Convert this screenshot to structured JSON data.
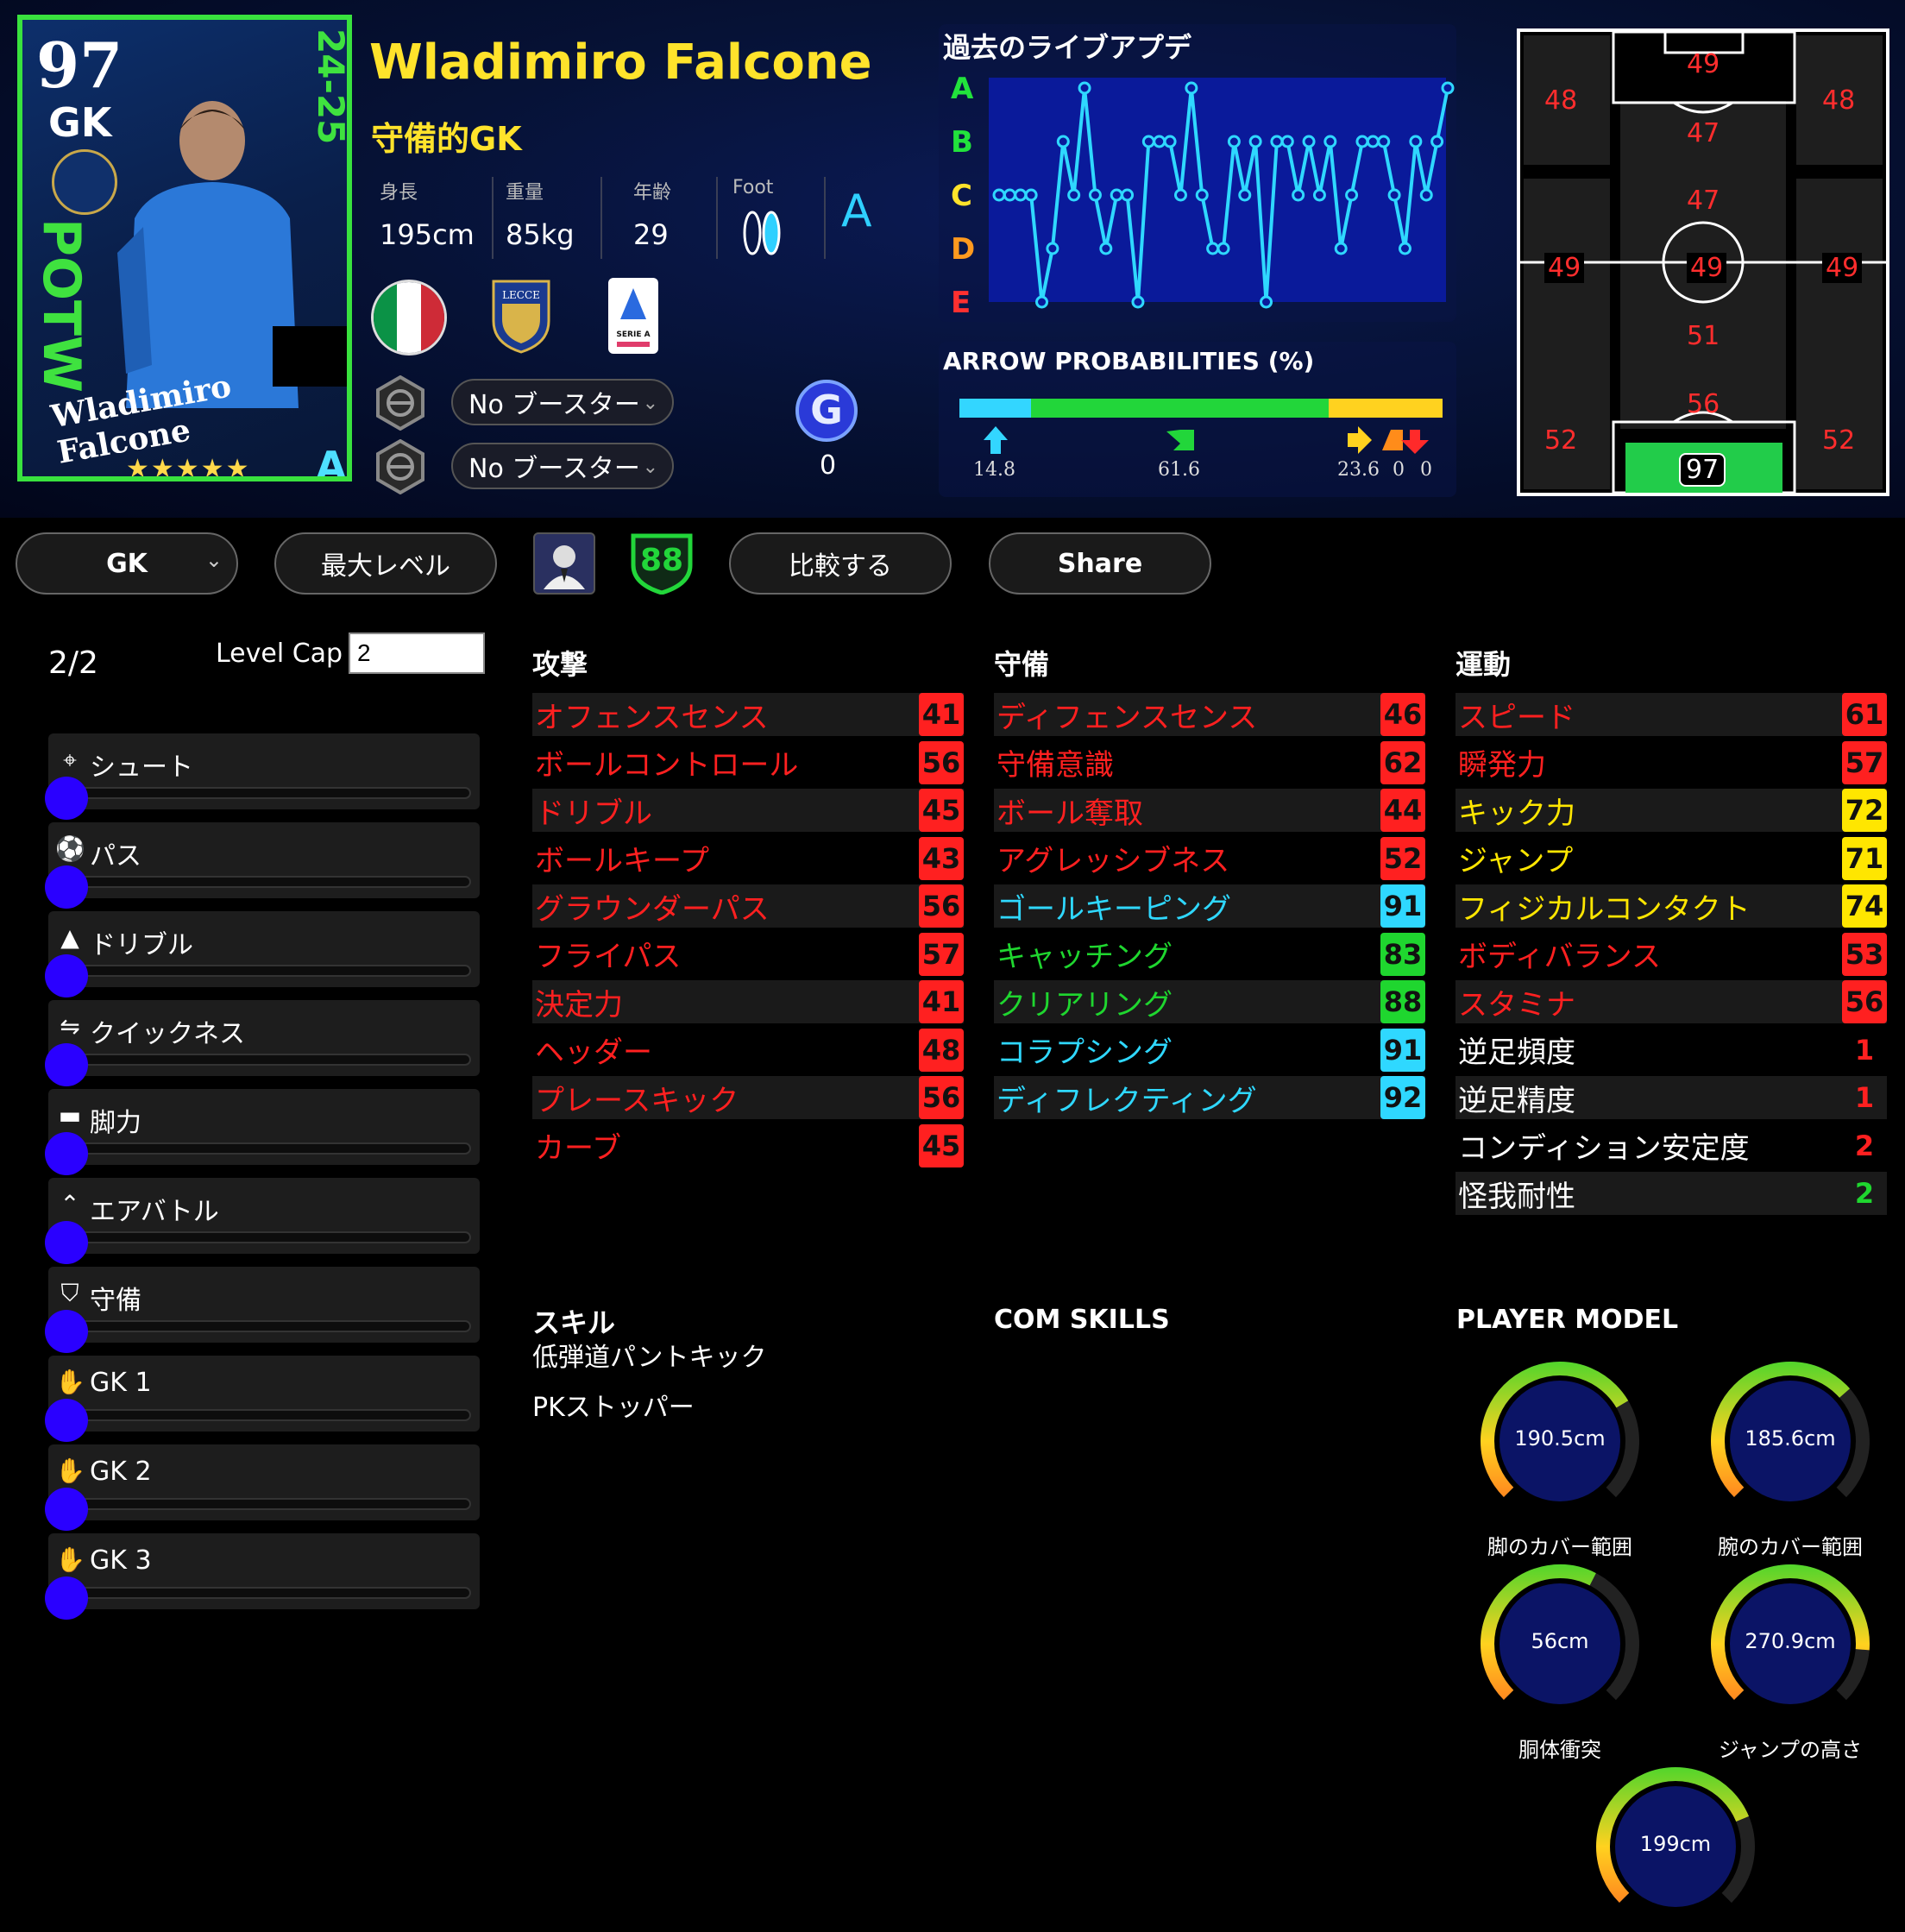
{
  "card": {
    "ovr": "97",
    "pos": "GK",
    "season": "24-25",
    "potw": "POTW",
    "name": "Wladimiro Falcone",
    "stars": "★★★★★",
    "grade": "A"
  },
  "player": {
    "name": "Wladimiro Falcone",
    "role": "守備的GK",
    "height_label": "身長",
    "height": "195cm",
    "weight_label": "重量",
    "weight": "85kg",
    "age_label": "年齢",
    "age": "29",
    "foot_label": "Foot",
    "foot_grade": "A",
    "league_text": "SERIE A",
    "club_text": "LECCE"
  },
  "boosters": [
    {
      "label": "No ブースター"
    },
    {
      "label": "No ブースター"
    }
  ],
  "g_badge": {
    "letter": "G",
    "count": "0"
  },
  "live_update": {
    "title": "過去のライブアプデ",
    "grades": [
      "A",
      "B",
      "C",
      "D",
      "E"
    ],
    "grade_colors": [
      "#22e23c",
      "#22e23c",
      "#ffe32b",
      "#ff9a1f",
      "#ff3030"
    ],
    "history": [
      "C",
      "C",
      "C",
      "C",
      "E",
      "D",
      "B",
      "C",
      "A",
      "C",
      "D",
      "C",
      "C",
      "E",
      "B",
      "B",
      "B",
      "C",
      "A",
      "C",
      "D",
      "D",
      "B",
      "C",
      "B",
      "E",
      "B",
      "B",
      "C",
      "B",
      "C",
      "B",
      "D",
      "C",
      "B",
      "B",
      "B",
      "C",
      "D",
      "B",
      "C",
      "B",
      "A"
    ]
  },
  "arrow_prob": {
    "title": "ARROW PROBABILITIES (%)",
    "values": [
      14.8,
      61.6,
      23.6,
      0,
      0
    ],
    "labels": [
      "14.8",
      "61.6",
      "23.6",
      "0",
      "0"
    ],
    "colors": [
      "#33d6ff",
      "#22d63a",
      "#ffd21f",
      "#ff8c1a",
      "#ff2a2a"
    ]
  },
  "positions": {
    "top_center": "49",
    "top_left": "48",
    "top_right": "48",
    "upper_mid": "47",
    "mid_top": "47",
    "left_mid": "49",
    "center": "49",
    "right_mid": "49",
    "mid_low": "51",
    "low_center": "56",
    "low_left": "52",
    "low_right": "52",
    "gk": "97"
  },
  "toolbar": {
    "position_select": "GK",
    "max_level": "最大レベル",
    "compare": "比較する",
    "share": "Share",
    "badge_value": "88"
  },
  "progression": {
    "count": "2/2",
    "level_cap_label": "Level Cap",
    "level_cap_value": "2",
    "items": [
      {
        "label": "シュート",
        "icon": "crosshair-icon",
        "glyph": "⌖",
        "level": 0
      },
      {
        "label": "パス",
        "icon": "ball-icon",
        "glyph": "⚽",
        "level": 0
      },
      {
        "label": "ドリブル",
        "icon": "cone-icon",
        "glyph": "▲",
        "level": 0
      },
      {
        "label": "クイックネス",
        "icon": "arrows-icon",
        "glyph": "⇋",
        "level": 0
      },
      {
        "label": "脚力",
        "icon": "boot-icon",
        "glyph": "▬",
        "level": 0
      },
      {
        "label": "エアバトル",
        "icon": "double-chevron-up-icon",
        "glyph": "⌃",
        "level": 0
      },
      {
        "label": "守備",
        "icon": "shield-icon",
        "glyph": "⛉",
        "level": 0
      },
      {
        "label": "GK 1",
        "icon": "glove-icon",
        "glyph": "✋",
        "level": 0
      },
      {
        "label": "GK 2",
        "icon": "glove-icon",
        "glyph": "✋",
        "level": 0
      },
      {
        "label": "GK 3",
        "icon": "glove-icon",
        "glyph": "✋",
        "level": 0
      }
    ]
  },
  "stats": {
    "colors": {
      "red": "#ff2020",
      "yellow": "#ffe600",
      "green": "#1fd62f",
      "cyan": "#2fd8ff"
    },
    "attack": {
      "title": "攻撃",
      "rows": [
        {
          "name": "オフェンスセンス",
          "value": "41",
          "tier": "red"
        },
        {
          "name": "ボールコントロール",
          "value": "56",
          "tier": "red"
        },
        {
          "name": "ドリブル",
          "value": "45",
          "tier": "red"
        },
        {
          "name": "ボールキープ",
          "value": "43",
          "tier": "red"
        },
        {
          "name": "グラウンダーパス",
          "value": "56",
          "tier": "red"
        },
        {
          "name": "フライパス",
          "value": "57",
          "tier": "red"
        },
        {
          "name": "決定力",
          "value": "41",
          "tier": "red"
        },
        {
          "name": "ヘッダー",
          "value": "48",
          "tier": "red"
        },
        {
          "name": "プレースキック",
          "value": "56",
          "tier": "red"
        },
        {
          "name": "カーブ",
          "value": "45",
          "tier": "red"
        }
      ]
    },
    "defense": {
      "title": "守備",
      "rows": [
        {
          "name": "ディフェンスセンス",
          "value": "46",
          "tier": "red"
        },
        {
          "name": "守備意識",
          "value": "62",
          "tier": "red"
        },
        {
          "name": "ボール奪取",
          "value": "44",
          "tier": "red"
        },
        {
          "name": "アグレッシブネス",
          "value": "52",
          "tier": "red"
        },
        {
          "name": "ゴールキーピング",
          "value": "91",
          "tier": "cyan"
        },
        {
          "name": "キャッチング",
          "value": "83",
          "tier": "green"
        },
        {
          "name": "クリアリング",
          "value": "88",
          "tier": "green"
        },
        {
          "name": "コラプシング",
          "value": "91",
          "tier": "cyan"
        },
        {
          "name": "ディフレクティング",
          "value": "92",
          "tier": "cyan"
        }
      ]
    },
    "physical": {
      "title": "運動",
      "rows": [
        {
          "name": "スピード",
          "value": "61",
          "tier": "red"
        },
        {
          "name": "瞬発力",
          "value": "57",
          "tier": "red"
        },
        {
          "name": "キック力",
          "value": "72",
          "tier": "yellow"
        },
        {
          "name": "ジャンプ",
          "value": "71",
          "tier": "yellow"
        },
        {
          "name": "フィジカルコンタクト",
          "value": "74",
          "tier": "yellow"
        },
        {
          "name": "ボディバランス",
          "value": "53",
          "tier": "red"
        },
        {
          "name": "スタミナ",
          "value": "56",
          "tier": "red"
        },
        {
          "name": "逆足頻度",
          "value": "1",
          "tier": "plain-red"
        },
        {
          "name": "逆足精度",
          "value": "1",
          "tier": "plain-red"
        },
        {
          "name": "コンディション安定度",
          "value": "2",
          "tier": "plain-red"
        },
        {
          "name": "怪我耐性",
          "value": "2",
          "tier": "plain-green"
        }
      ]
    }
  },
  "skills": {
    "title": "スキル",
    "items": [
      "低弾道パントキック",
      "PKストッパー"
    ]
  },
  "com_skills": {
    "title": "COM SKILLS"
  },
  "player_model": {
    "title": "PLAYER MODEL",
    "gauges": [
      {
        "value": "190.5cm",
        "label": "脚のカバー範囲",
        "level": 0.72
      },
      {
        "value": "185.6cm",
        "label": "腕のカバー範囲",
        "level": 0.68
      },
      {
        "value": "56cm",
        "label": "胴体衝突",
        "level": 0.6
      },
      {
        "value": "270.9cm",
        "label": "ジャンプの高さ",
        "level": 0.85
      },
      {
        "value": "199cm",
        "label": "",
        "level": 0.75
      }
    ]
  }
}
